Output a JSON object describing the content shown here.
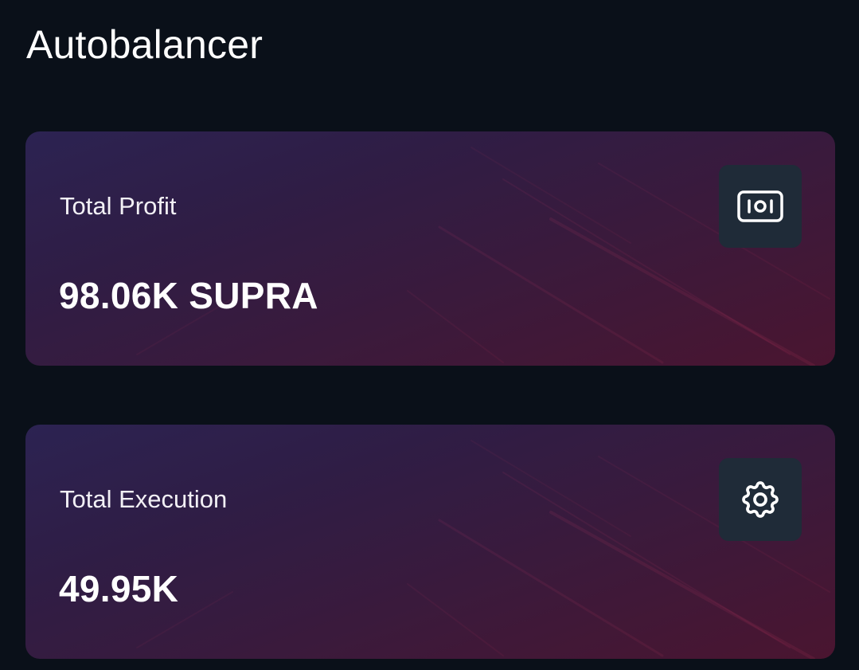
{
  "header": {
    "title": "Autobalancer"
  },
  "stats": [
    {
      "label": "Total Profit",
      "value": "98.06K SUPRA",
      "icon": "banknote-icon"
    },
    {
      "label": "Total Execution",
      "value": "49.95K",
      "icon": "gear-icon"
    }
  ],
  "colors": {
    "background": "#0a1019",
    "card_gradient_start": "#2c2352",
    "card_gradient_end": "#4a1530",
    "icon_box": "#1f2b38",
    "text": "#ffffff"
  }
}
